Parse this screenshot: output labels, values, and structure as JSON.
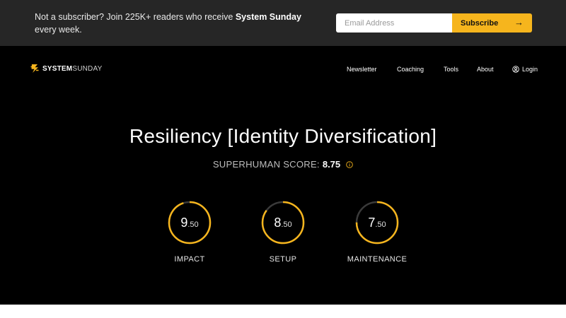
{
  "promo_bar": {
    "text_before": "Not a subscriber? Join 225K+ readers who receive ",
    "brand": "System Sunday",
    "text_after": " every week.",
    "email_placeholder": "Email Address",
    "subscribe_label": "Subscribe",
    "subscribe_icon": "arrow-right-icon"
  },
  "header": {
    "logo_icon": "bolt-s-icon",
    "logo_bold": "SYSTEM",
    "logo_light": "SUNDAY",
    "nav": [
      {
        "label": "Newsletter"
      },
      {
        "label": "Coaching"
      },
      {
        "label": "Tools"
      },
      {
        "label": "About"
      },
      {
        "label": "Login",
        "icon": "user-icon"
      }
    ]
  },
  "hero": {
    "title": "Resiliency [Identity Diversification]",
    "score_label": "SUPERHUMAN SCORE:",
    "score_value": "8.75",
    "info_icon": "info-icon",
    "metrics": [
      {
        "label": "IMPACT",
        "whole": "9",
        "decimal": ".50",
        "value": 9.5,
        "max": 10
      },
      {
        "label": "SETUP",
        "whole": "8",
        "decimal": ".50",
        "value": 8.5,
        "max": 10
      },
      {
        "label": "MAINTENANCE",
        "whole": "7",
        "decimal": ".50",
        "value": 7.5,
        "max": 10
      }
    ]
  },
  "colors": {
    "accent": "#f6b51d",
    "ring_track": "#3a3a3a",
    "hero_bg": "#000000",
    "topbar_bg": "#262626"
  }
}
